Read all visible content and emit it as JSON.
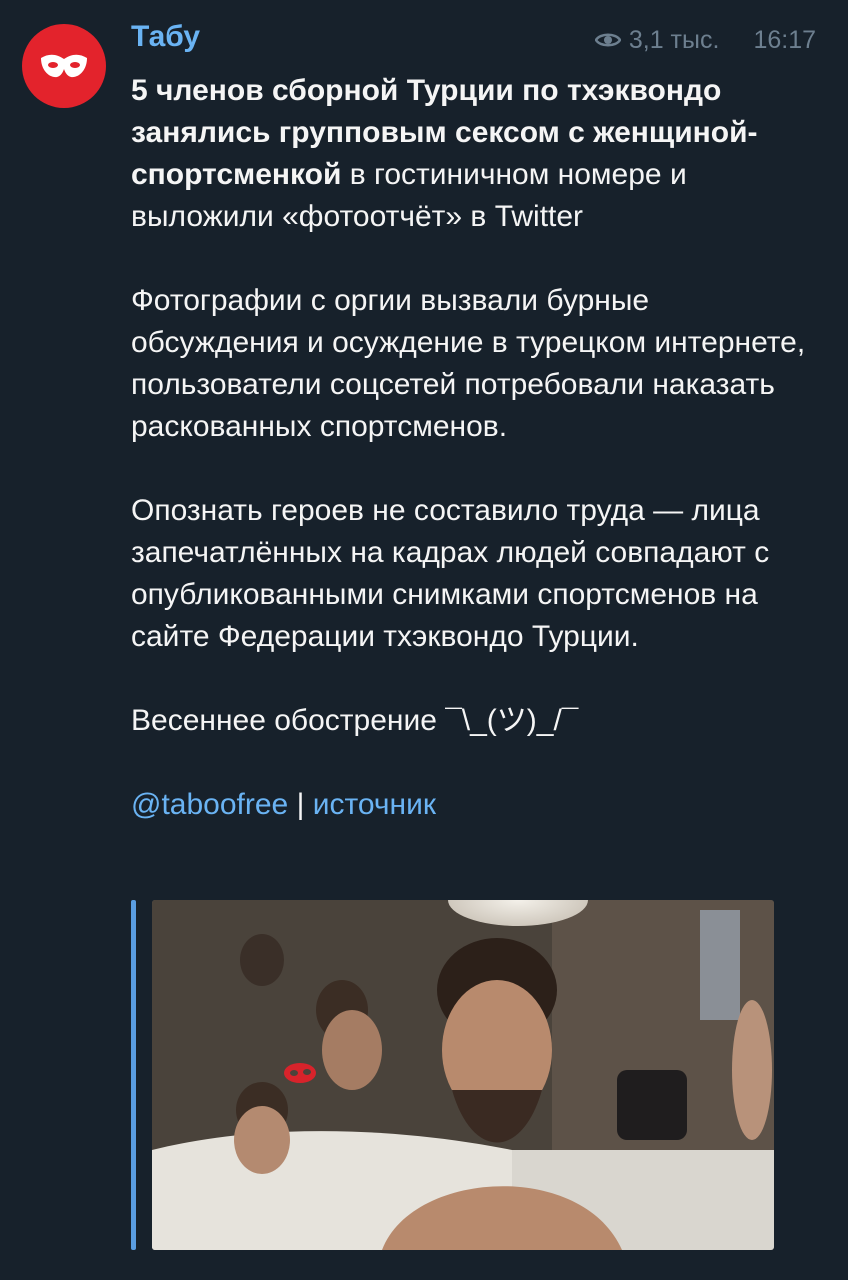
{
  "channel": {
    "name": "Табу",
    "views": "3,1 тыс.",
    "time": "16:17"
  },
  "icons": {
    "avatar": "red-mask-icon",
    "views": "eye-icon"
  },
  "colors": {
    "background": "#17212b",
    "accent": "#6ab3f3",
    "avatar": "#e3232c",
    "text": "#f5f5f5",
    "meta": "#6d7f8f"
  },
  "post": {
    "headline_bold": "5 членов сборной Турции по тхэквондо занялись групповым сексом с женщиной-спортсменкой",
    "headline_rest": " в гостиничном номере и выложили «фотоотчёт» в Twitter",
    "paragraph2": "Фотографии с оргии вызвали бурные обсуждения и осуждение в турецком интернете, пользователи соцсетей потребовали наказать раскованных спортсменов.",
    "paragraph3": "Опознать героев не составило труда — лица запечатлённых на кадрах людей совпадают с опубликованными снимками спортсменов на сайте Федерации тхэквондо Турции.",
    "paragraph4": "Весеннее обострение ¯\\_(ツ)_/¯",
    "footer_handle": "@taboofree",
    "footer_separator": " | ",
    "footer_source": "источник"
  }
}
